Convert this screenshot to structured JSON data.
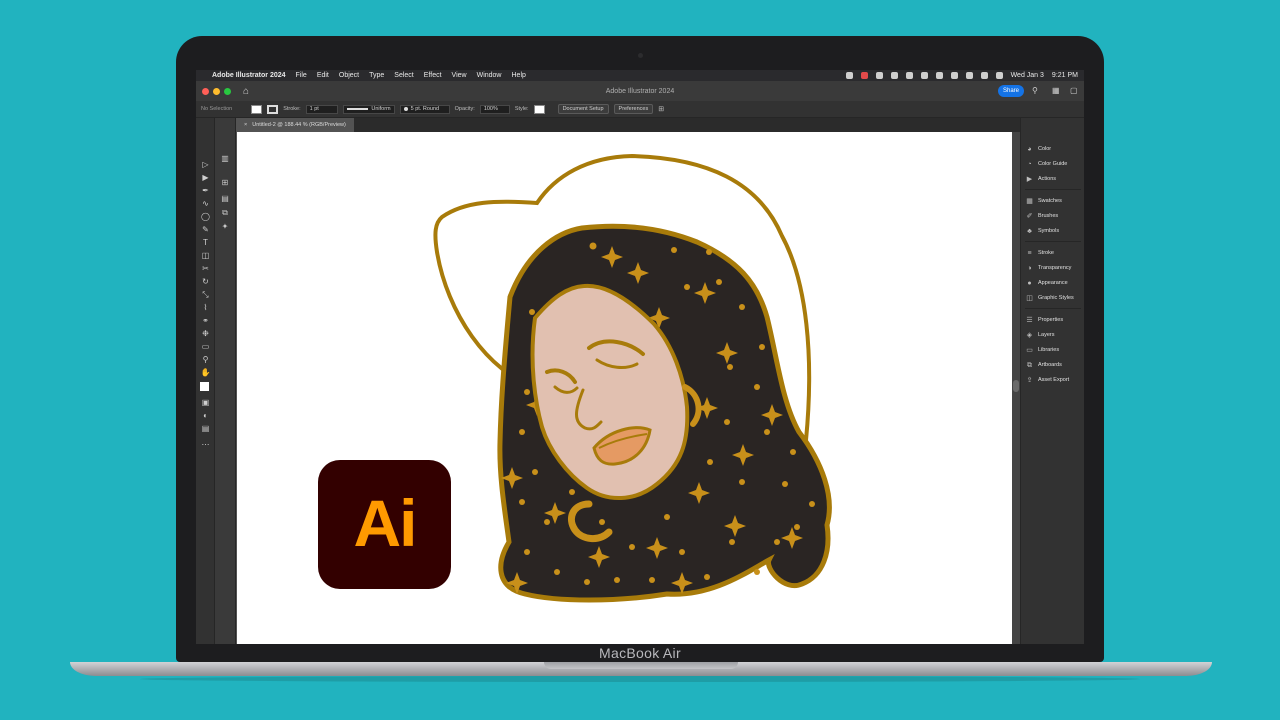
{
  "menubar": {
    "apple": "",
    "app_name": "Adobe Illustrator 2024",
    "items": [
      "File",
      "Edit",
      "Object",
      "Type",
      "Select",
      "Effect",
      "View",
      "Window",
      "Help"
    ],
    "date": "Wed Jan 3",
    "time": "9:21 PM"
  },
  "titlebar": {
    "title": "Adobe Illustrator 2024",
    "share_label": "Share"
  },
  "controlbar": {
    "selection": "No Selection",
    "stroke_label": "Stroke:",
    "stroke_value": "1 pt",
    "profile": "Uniform",
    "brush": "5 pt. Round",
    "opacity_label": "Opacity:",
    "opacity_value": "100%",
    "style_label": "Style:",
    "document_setup": "Document Setup",
    "preferences": "Preferences"
  },
  "tab": {
    "close": "×",
    "label": "Untitled-2 @ 188.44 % (RGB/Preview)"
  },
  "panels": [
    {
      "label": "Color",
      "icon": "color-icon"
    },
    {
      "label": "Color Guide",
      "icon": "color-guide-icon"
    },
    {
      "label": "Actions",
      "icon": "actions-icon"
    },
    {
      "label": "Swatches",
      "icon": "swatches-icon"
    },
    {
      "label": "Brushes",
      "icon": "brushes-icon"
    },
    {
      "label": "Symbols",
      "icon": "symbols-icon"
    },
    {
      "label": "Stroke",
      "icon": "stroke-icon"
    },
    {
      "label": "Transparency",
      "icon": "transparency-icon"
    },
    {
      "label": "Appearance",
      "icon": "appearance-icon"
    },
    {
      "label": "Graphic Styles",
      "icon": "graphic-styles-icon"
    },
    {
      "label": "Properties",
      "icon": "properties-icon"
    },
    {
      "label": "Layers",
      "icon": "layers-icon"
    },
    {
      "label": "Libraries",
      "icon": "libraries-icon"
    },
    {
      "label": "Artboards",
      "icon": "artboards-icon"
    },
    {
      "label": "Asset Export",
      "icon": "asset-export-icon"
    }
  ],
  "logo": {
    "text": "Ai"
  },
  "laptop": {
    "label": "MacBook Air"
  },
  "colors": {
    "background": "#21b3bf",
    "illustration_outline": "#a87b0a",
    "hair": "#2a2523",
    "skin": "#e1c0b0",
    "gold": "#c8901a",
    "lips": "#e59a63",
    "logo_bg": "#330000",
    "logo_text": "#ff9a00",
    "share_blue": "#1473e6"
  }
}
